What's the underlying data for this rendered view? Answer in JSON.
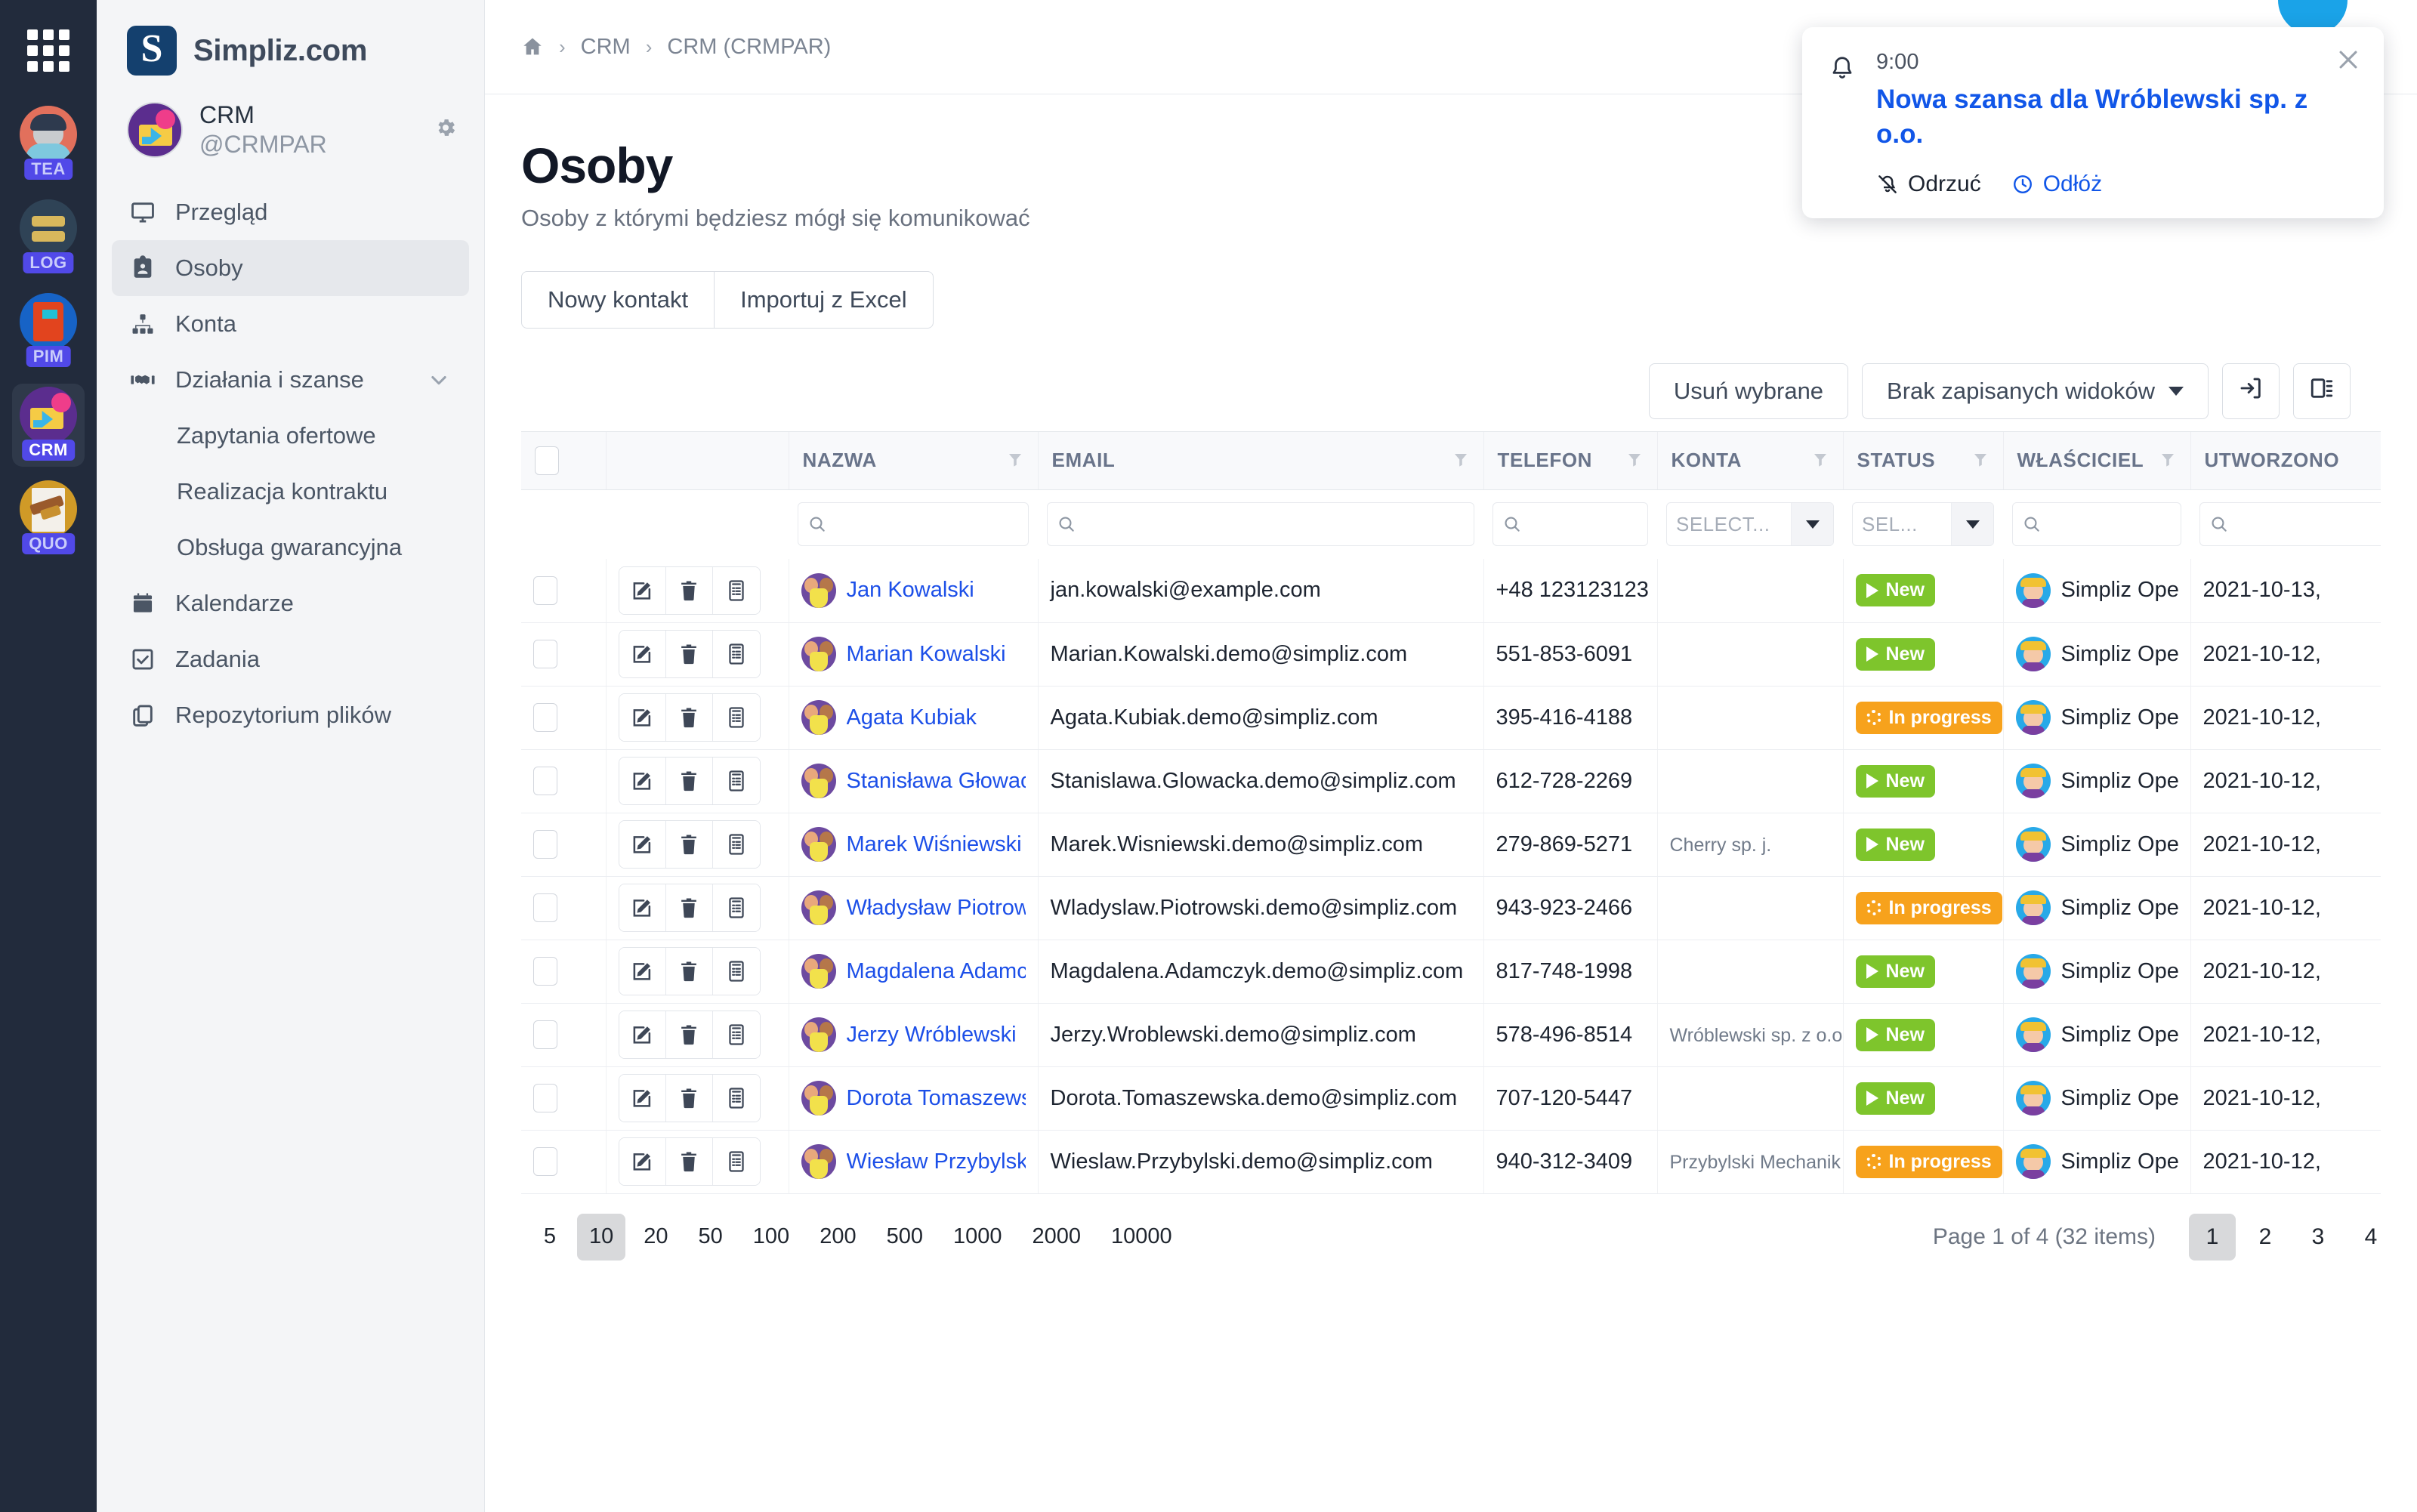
{
  "rail": {
    "apps_icon": "grid-apps-icon",
    "items": [
      {
        "badge": "TEA",
        "name": "team-app"
      },
      {
        "badge": "LOG",
        "name": "logistics-app"
      },
      {
        "badge": "PIM",
        "name": "pim-app"
      },
      {
        "badge": "CRM",
        "name": "crm-app",
        "active": true
      },
      {
        "badge": "QUO",
        "name": "quotes-app"
      }
    ]
  },
  "sidebar": {
    "brand": {
      "logo_letter": "S",
      "name": "Simpliz.com"
    },
    "workspace": {
      "title": "CRM",
      "handle": "@CRMPAR",
      "gear_icon": "gear-icon"
    },
    "nav": [
      {
        "label": "Przegląd",
        "icon": "monitor-icon",
        "active": false,
        "type": "item"
      },
      {
        "label": "Osoby",
        "icon": "contact-card-icon",
        "active": true,
        "type": "item"
      },
      {
        "label": "Konta",
        "icon": "org-chart-icon",
        "active": false,
        "type": "item"
      },
      {
        "label": "Działania i szanse",
        "icon": "handshake-icon",
        "active": false,
        "type": "group",
        "expanded": true
      },
      {
        "label": "Zapytania ofertowe",
        "type": "sub"
      },
      {
        "label": "Realizacja kontraktu",
        "type": "sub"
      },
      {
        "label": "Obsługa gwarancyjna",
        "type": "sub"
      },
      {
        "label": "Kalendarze",
        "icon": "calendar-icon",
        "active": false,
        "type": "item"
      },
      {
        "label": "Zadania",
        "icon": "checkbox-icon",
        "active": false,
        "type": "item"
      },
      {
        "label": "Repozytorium plików",
        "icon": "copy-files-icon",
        "active": false,
        "type": "item"
      }
    ]
  },
  "breadcrumb": {
    "home_icon": "home-icon",
    "items": [
      "CRM",
      "CRM (CRMPAR)"
    ],
    "separator": "›"
  },
  "page": {
    "title": "Osoby",
    "subtitle": "Osoby z którymi będziesz mógł się komunikować"
  },
  "actions": {
    "new_contact": "Nowy kontakt",
    "import_excel": "Importuj z Excel"
  },
  "toolbar": {
    "delete_selected": "Usuń wybrane",
    "saved_views": "Brak zapisanych widoków",
    "export_icon": "export-arrow-icon",
    "columns_icon": "columns-layout-icon"
  },
  "table": {
    "columns": [
      {
        "key": "select",
        "label": "",
        "filter": false
      },
      {
        "key": "actions",
        "label": "",
        "filter": false
      },
      {
        "key": "nazwa",
        "label": "NAZWA",
        "filter": true,
        "filter_type": "search"
      },
      {
        "key": "email",
        "label": "EMAIL",
        "filter": true,
        "filter_type": "search"
      },
      {
        "key": "telefon",
        "label": "TELEFON",
        "filter": true,
        "filter_type": "search"
      },
      {
        "key": "konta",
        "label": "KONTA",
        "filter": true,
        "filter_type": "select",
        "filter_placeholder": "SELECT..."
      },
      {
        "key": "status",
        "label": "STATUS",
        "filter": true,
        "filter_type": "select",
        "filter_placeholder": "SEL..."
      },
      {
        "key": "wlasciciel",
        "label": "WŁAŚCICIEL",
        "filter": true,
        "filter_type": "search"
      },
      {
        "key": "utworzono",
        "label": "UTWORZONO",
        "filter": false,
        "filter_type": "search"
      }
    ],
    "row_action_icons": [
      "edit-pencil-icon",
      "trash-delete-icon",
      "details-list-icon"
    ],
    "rows": [
      {
        "nazwa": "Jan Kowalski",
        "email": "jan.kowalski@example.com",
        "telefon": "+48 123123123",
        "konta": "",
        "status": "New",
        "status_kind": "new",
        "wlasciciel": "Simpliz Opera",
        "utworzono": "2021-10-13, "
      },
      {
        "nazwa": "Marian Kowalski",
        "email": "Marian.Kowalski.demo@simpliz.com",
        "telefon": "551-853-6091",
        "konta": "",
        "status": "New",
        "status_kind": "new",
        "wlasciciel": "Simpliz Opera",
        "utworzono": "2021-10-12, "
      },
      {
        "nazwa": "Agata Kubiak",
        "email": "Agata.Kubiak.demo@simpliz.com",
        "telefon": "395-416-4188",
        "konta": "",
        "status": "In progress",
        "status_kind": "prog",
        "wlasciciel": "Simpliz Opera",
        "utworzono": "2021-10-12, "
      },
      {
        "nazwa": "Stanisława Głowacka",
        "email": "Stanislawa.Glowacka.demo@simpliz.com",
        "telefon": "612-728-2269",
        "konta": "",
        "status": "New",
        "status_kind": "new",
        "wlasciciel": "Simpliz Opera",
        "utworzono": "2021-10-12, "
      },
      {
        "nazwa": "Marek Wiśniewski",
        "email": "Marek.Wisniewski.demo@simpliz.com",
        "telefon": "279-869-5271",
        "konta": "Cherry sp. j.",
        "status": "New",
        "status_kind": "new",
        "wlasciciel": "Simpliz Opera",
        "utworzono": "2021-10-12, "
      },
      {
        "nazwa": "Władysław Piotrowski",
        "email": "Wladyslaw.Piotrowski.demo@simpliz.com",
        "telefon": "943-923-2466",
        "konta": "",
        "status": "In progress",
        "status_kind": "prog",
        "wlasciciel": "Simpliz Opera",
        "utworzono": "2021-10-12, "
      },
      {
        "nazwa": "Magdalena Adamczyk",
        "email": "Magdalena.Adamczyk.demo@simpliz.com",
        "telefon": "817-748-1998",
        "konta": "",
        "status": "New",
        "status_kind": "new",
        "wlasciciel": "Simpliz Opera",
        "utworzono": "2021-10-12, "
      },
      {
        "nazwa": "Jerzy Wróblewski",
        "email": "Jerzy.Wroblewski.demo@simpliz.com",
        "telefon": "578-496-8514",
        "konta": "Wróblewski sp. z o.o.",
        "status": "New",
        "status_kind": "new",
        "wlasciciel": "Simpliz Opera",
        "utworzono": "2021-10-12, "
      },
      {
        "nazwa": "Dorota Tomaszewska",
        "email": "Dorota.Tomaszewska.demo@simpliz.com",
        "telefon": "707-120-5447",
        "konta": "",
        "status": "New",
        "status_kind": "new",
        "wlasciciel": "Simpliz Opera",
        "utworzono": "2021-10-12, "
      },
      {
        "nazwa": "Wiesław Przybylski",
        "email": "Wieslaw.Przybylski.demo@simpliz.com",
        "telefon": "940-312-3409",
        "konta": "Przybylski Mechanik",
        "status": "In progress",
        "status_kind": "prog",
        "wlasciciel": "Simpliz Opera",
        "utworzono": "2021-10-12, "
      }
    ]
  },
  "pagination": {
    "page_sizes": [
      "5",
      "10",
      "20",
      "50",
      "100",
      "200",
      "500",
      "1000",
      "2000",
      "10000"
    ],
    "selected_size": "10",
    "info": "Page 1 of 4 (32 items)",
    "pages": [
      "1",
      "2",
      "3",
      "4"
    ],
    "selected_page": "1"
  },
  "toast": {
    "bell_icon": "bell-icon",
    "time": "9:00",
    "title": "Nowa szansa dla Wróblewski sp. z o.o.",
    "close_icon": "close-x-icon",
    "dismiss_label": "Odrzuć",
    "dismiss_icon": "bell-off-icon",
    "snooze_label": "Odłóż",
    "snooze_icon": "clock-icon"
  },
  "colors": {
    "rail_bg": "#222b3c",
    "sidebar_bg": "#f4f5f7",
    "link_blue": "#1c4fe8",
    "status_new": "#7ec52c",
    "status_progress": "#f7a21c",
    "toast_blue": "#1156e8"
  }
}
